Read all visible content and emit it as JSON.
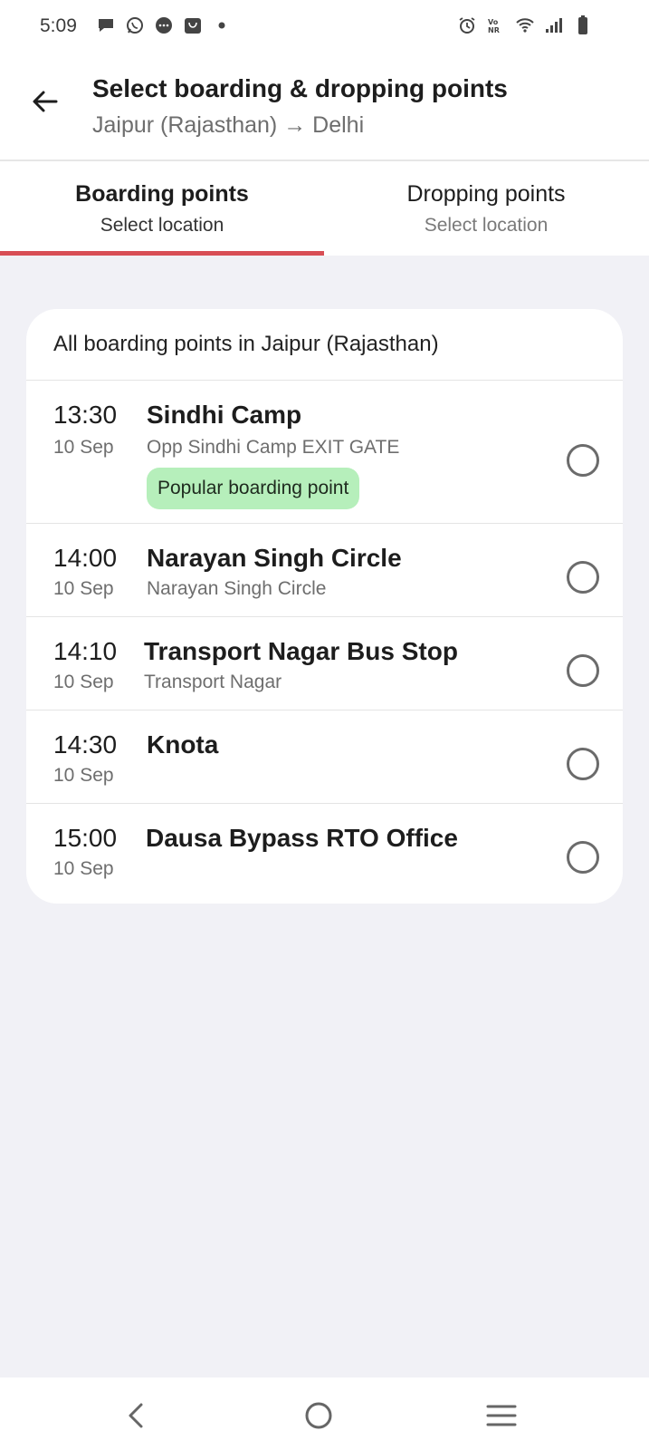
{
  "status_bar": {
    "time": "5:09",
    "left_icons": [
      "chat-bubble-icon",
      "whatsapp-icon",
      "messages-icon",
      "shopping-bag-icon",
      "dot-icon"
    ],
    "right_icons": [
      "alarm-icon",
      "volte-icon",
      "wifi-icon",
      "signal-icon",
      "battery-icon"
    ]
  },
  "header": {
    "title": "Select boarding & dropping points",
    "subtitle": "Jaipur (Rajasthan) → Delhi"
  },
  "tabs": [
    {
      "title": "Boarding points",
      "subtitle": "Select location",
      "active": true
    },
    {
      "title": "Dropping points",
      "subtitle": "Select location",
      "active": false
    }
  ],
  "card": {
    "header": "All boarding points in Jaipur (Rajasthan)",
    "points": [
      {
        "time": "13:30",
        "date": "10 Sep",
        "name": "Sindhi Camp",
        "address": "Opp Sindhi Camp EXIT GATE",
        "badge": "Popular boarding point"
      },
      {
        "time": "14:00",
        "date": "10 Sep",
        "name": "Narayan Singh Circle",
        "address": "Narayan Singh Circle"
      },
      {
        "time": "14:10",
        "date": "10 Sep",
        "name": "Transport Nagar Bus Stop",
        "address": "Transport Nagar"
      },
      {
        "time": "14:30",
        "date": "10 Sep",
        "name": "Knota"
      },
      {
        "time": "15:00",
        "date": "10 Sep",
        "name": "Dausa Bypass RTO Office"
      }
    ]
  },
  "colors": {
    "accent": "#d84e55",
    "badge_bg": "#b6efbb",
    "page_bg": "#f1f1f6"
  },
  "nav_bar": {
    "buttons": [
      "back-nav-icon",
      "home-nav-icon",
      "recents-nav-icon"
    ]
  }
}
